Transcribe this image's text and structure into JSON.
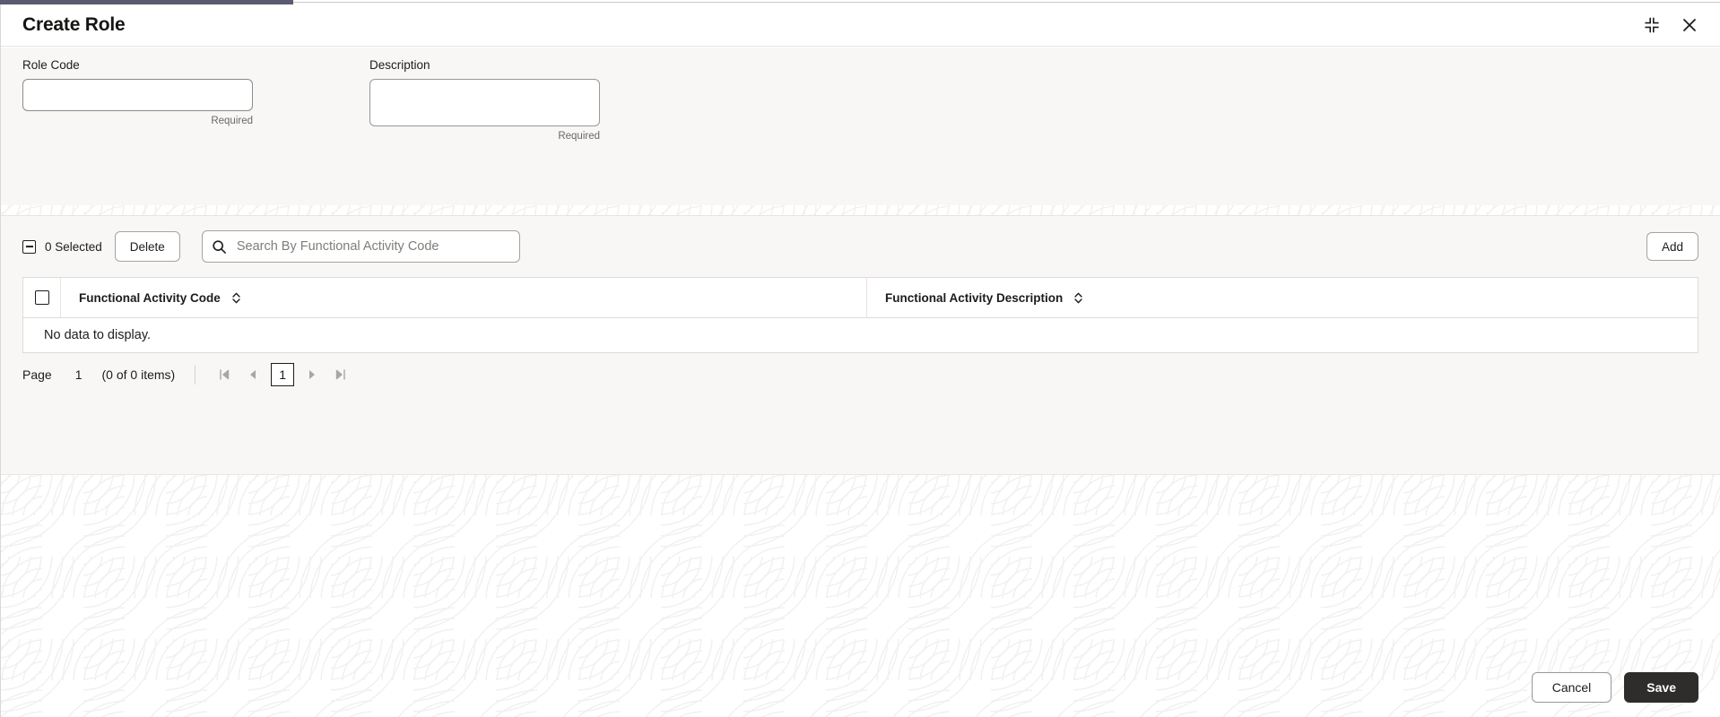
{
  "window": {
    "title": "Create Role",
    "accent_color": "#5a5a72",
    "minimize_icon": "collapse-icon",
    "close_icon": "close-icon"
  },
  "form": {
    "role_code": {
      "label": "Role Code",
      "value": "",
      "placeholder": "",
      "helper": "Required"
    },
    "description": {
      "label": "Description",
      "value": "",
      "placeholder": "",
      "helper": "Required"
    }
  },
  "toolbar": {
    "selected_label": "0 Selected",
    "delete_label": "Delete",
    "add_label": "Add",
    "search": {
      "value": "",
      "placeholder": "Search By Functional Activity Code",
      "icon": "search-icon"
    }
  },
  "grid": {
    "columns": [
      {
        "label": "Functional Activity Code",
        "sort_icon": "sort-chevrons-icon"
      },
      {
        "label": "Functional Activity Description",
        "sort_icon": "sort-chevrons-icon"
      }
    ],
    "rows": [],
    "empty_message": "No data to display."
  },
  "pagination": {
    "page_word": "Page",
    "page_number": "1",
    "items_summary": "(0 of 0 items)",
    "first_icon": "first-page-icon",
    "prev_icon": "previous-page-icon",
    "current_page": "1",
    "next_icon": "next-page-icon",
    "last_icon": "last-page-icon"
  },
  "footer": {
    "cancel_label": "Cancel",
    "save_label": "Save",
    "save_bg": "#2f2d2b"
  }
}
